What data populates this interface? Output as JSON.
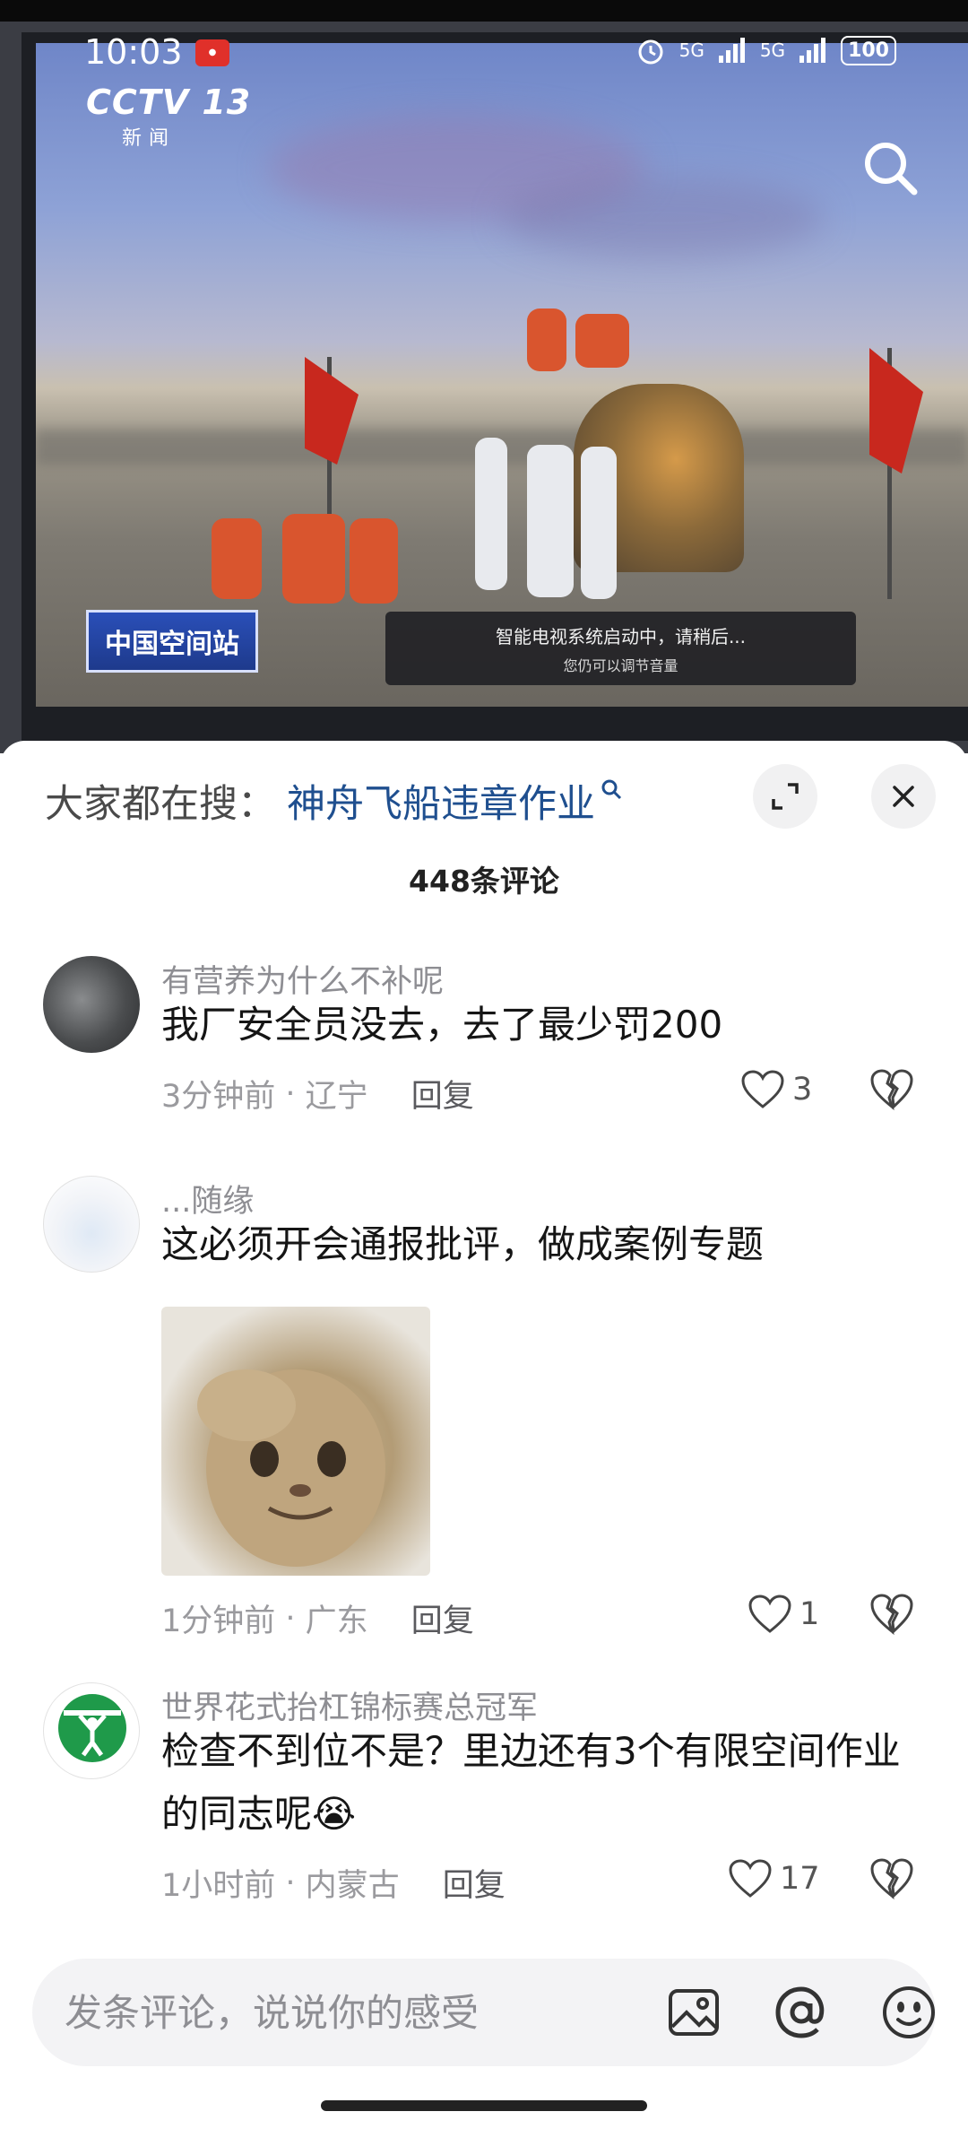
{
  "status_bar": {
    "time": "10:03",
    "signal_1": "5G",
    "signal_2": "5G",
    "battery": "100"
  },
  "video": {
    "channel": "CCTV 13",
    "channel_sub": "新闻",
    "banner_left": "中国空间站",
    "tv_notice_line1": "智能电视系统启动中，请稍后...",
    "tv_notice_line2": "您仍可以调节音量"
  },
  "hot_search": {
    "label": "大家都在搜：",
    "term": "神舟飞船违章作业"
  },
  "comment_count": "448条评论",
  "comments": [
    {
      "user": "有营养为什么不补呢",
      "text": "我厂安全员没去，去了最少罚200",
      "time": "3分钟前",
      "location": "辽宁",
      "reply": "回复",
      "likes": "3"
    },
    {
      "user": "...随缘",
      "text": "这必须开会通报批评，做成案例专题",
      "time": "1分钟前",
      "location": "广东",
      "reply": "回复",
      "likes": "1"
    },
    {
      "user": "世界花式抬杠锦标赛总冠军",
      "text": "检查不到位不是？里边还有3个有限空间作业的同志呢😭",
      "time": "1小时前",
      "location": "内蒙古",
      "reply": "回复",
      "likes": "17"
    }
  ],
  "input": {
    "placeholder": "发条评论，说说你的感受"
  },
  "icons": {
    "search": "search-icon",
    "expand": "expand-icon",
    "close": "close-icon",
    "like": "heart-icon",
    "dislike": "broken-heart-icon",
    "image": "image-icon",
    "mention": "at-icon",
    "emoji": "emoji-icon"
  },
  "colors": {
    "hot_search_term": "#1f4f8f",
    "meta_gray": "#9a9a9e",
    "sheet_bg": "#ffffff"
  }
}
